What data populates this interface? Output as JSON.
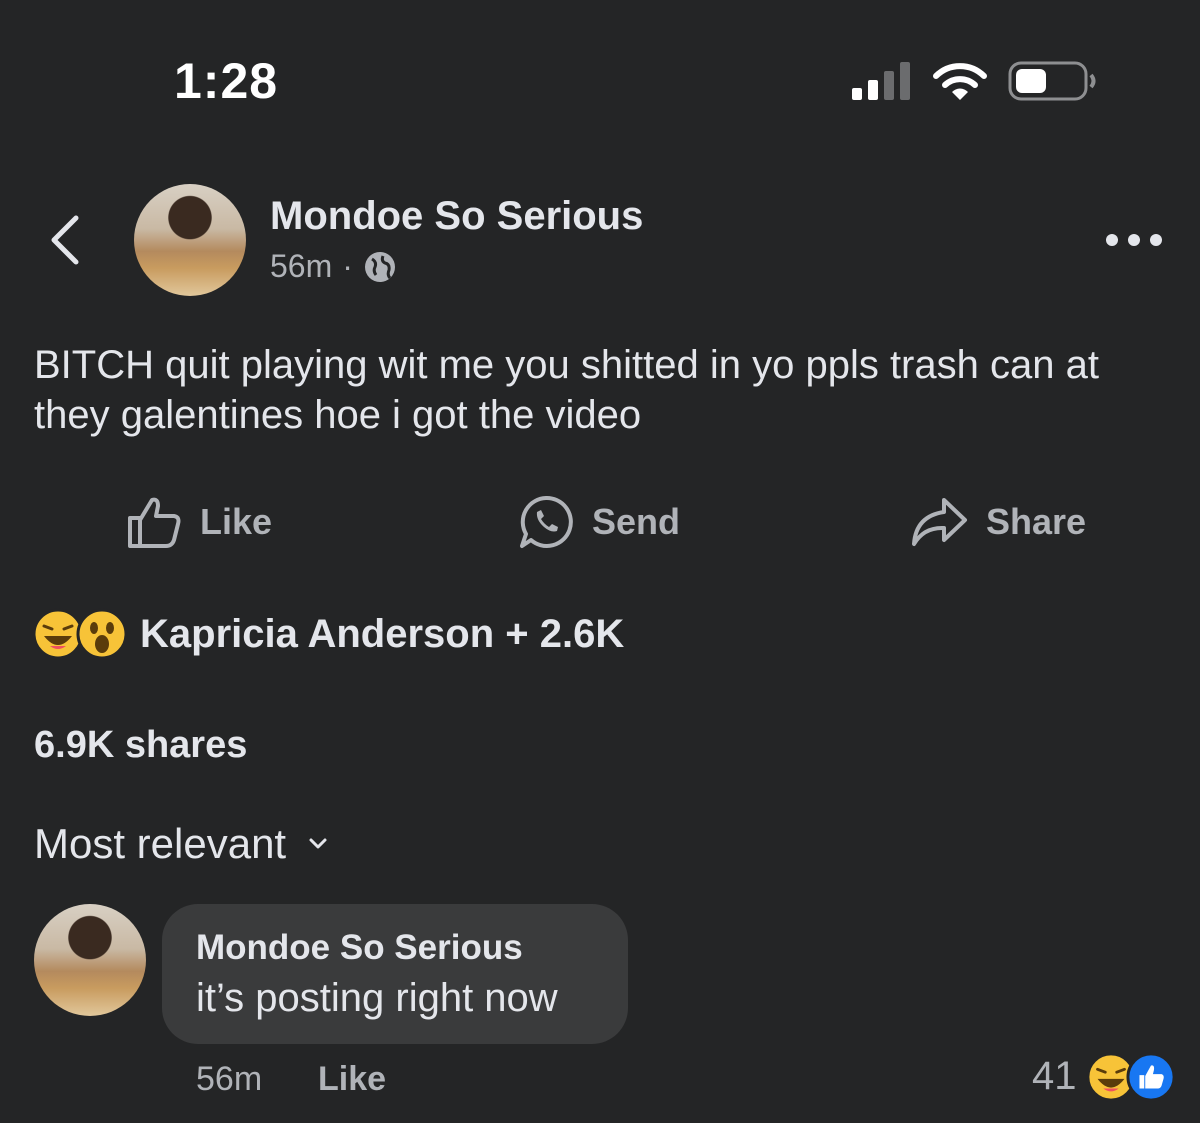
{
  "status_bar": {
    "time": "1:28"
  },
  "post": {
    "author": "Mondoe So Serious",
    "time": "56m",
    "separator": "·",
    "privacy_icon": "globe-icon",
    "text": "BITCH quit playing wit me you shitted in yo ppls trash can at they galentines hoe i got the video"
  },
  "actions": {
    "like": "Like",
    "send": "Send",
    "share": "Share"
  },
  "reactions": {
    "icons": [
      "haha-emoji-icon",
      "wow-emoji-icon"
    ],
    "summary": "Kapricia Anderson + 2.6K"
  },
  "shares": "6.9K shares",
  "sort": {
    "label": "Most relevant"
  },
  "comments": [
    {
      "author": "Mondoe So Serious",
      "text": "it’s posting right now",
      "time": "56m",
      "like_label": "Like",
      "reaction_count": "41",
      "reaction_icons": [
        "haha-emoji-icon",
        "like-reaction-icon"
      ]
    }
  ],
  "colors": {
    "background": "#242526",
    "bubble": "#3a3b3c",
    "primary_text": "#e4e6eb",
    "secondary_text": "#b0b3b8",
    "like_blue": "#1877f2"
  }
}
